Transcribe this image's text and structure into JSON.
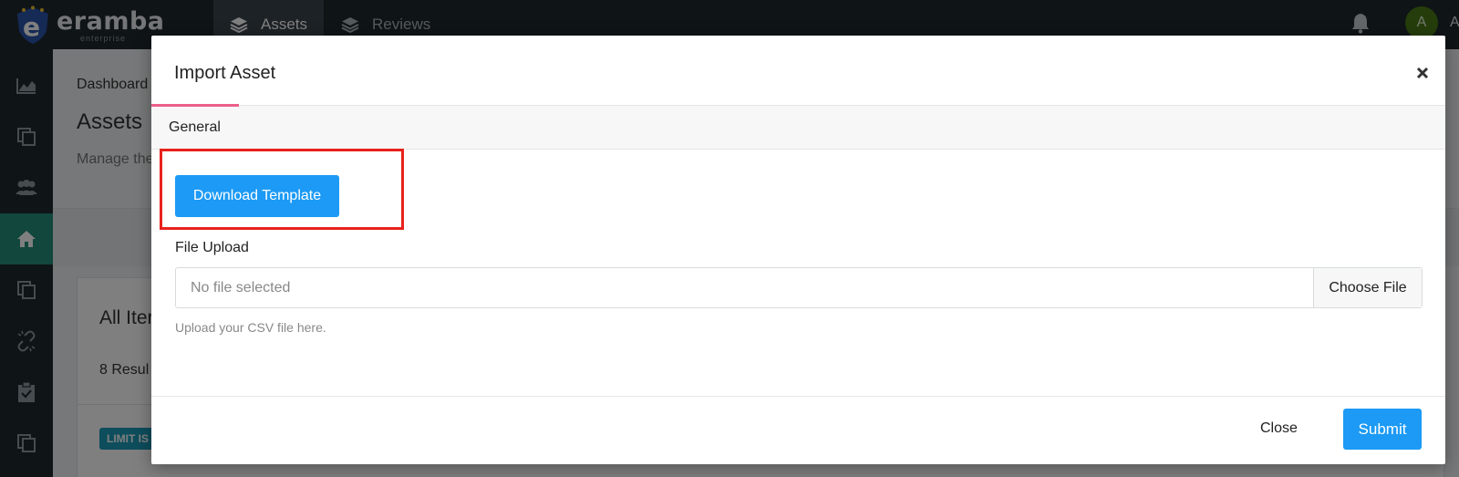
{
  "app": {
    "logo_text": "eramba",
    "logo_subtext": "enterprise",
    "logo_icon": "eramba-logo-icon"
  },
  "topnav": {
    "tabs": [
      {
        "label": "Assets",
        "icon": "layers-icon",
        "active": true
      },
      {
        "label": "Reviews",
        "icon": "layers-icon",
        "active": false
      }
    ],
    "notification_icon": "bell-icon",
    "avatar_initial": "A",
    "user_name_fragment": "A"
  },
  "sidebar": {
    "items": [
      {
        "icon": "chart-icon",
        "active": false
      },
      {
        "icon": "copy-icon",
        "active": false
      },
      {
        "icon": "users-icon",
        "active": false
      },
      {
        "icon": "home-icon",
        "active": true
      },
      {
        "icon": "copy-icon",
        "active": false
      },
      {
        "icon": "unlink-icon",
        "active": false
      },
      {
        "icon": "clipboard-check-icon",
        "active": false
      },
      {
        "icon": "copy-icon",
        "active": false
      }
    ]
  },
  "page": {
    "breadcrumb": "Dashboard",
    "title": "Assets",
    "description": "Manage the",
    "card_title": "All Iter",
    "card_results": "8 Resul",
    "limit_badge": "LIMIT IS"
  },
  "modal": {
    "title": "Import Asset",
    "close_icon": "close-icon",
    "tab_general": "General",
    "download_template_label": "Download Template",
    "file_upload_label": "File Upload",
    "file_input_value": "No file selected",
    "choose_file_label": "Choose File",
    "upload_help": "Upload your CSV file here.",
    "close_label": "Close",
    "submit_label": "Submit"
  },
  "colors": {
    "topbar_bg": "#1f282e",
    "sidebar_active": "#238e7a",
    "primary_button": "#1c9af5",
    "tab_indicator": "#ec5f8a",
    "highlight_border": "#e8221b"
  }
}
